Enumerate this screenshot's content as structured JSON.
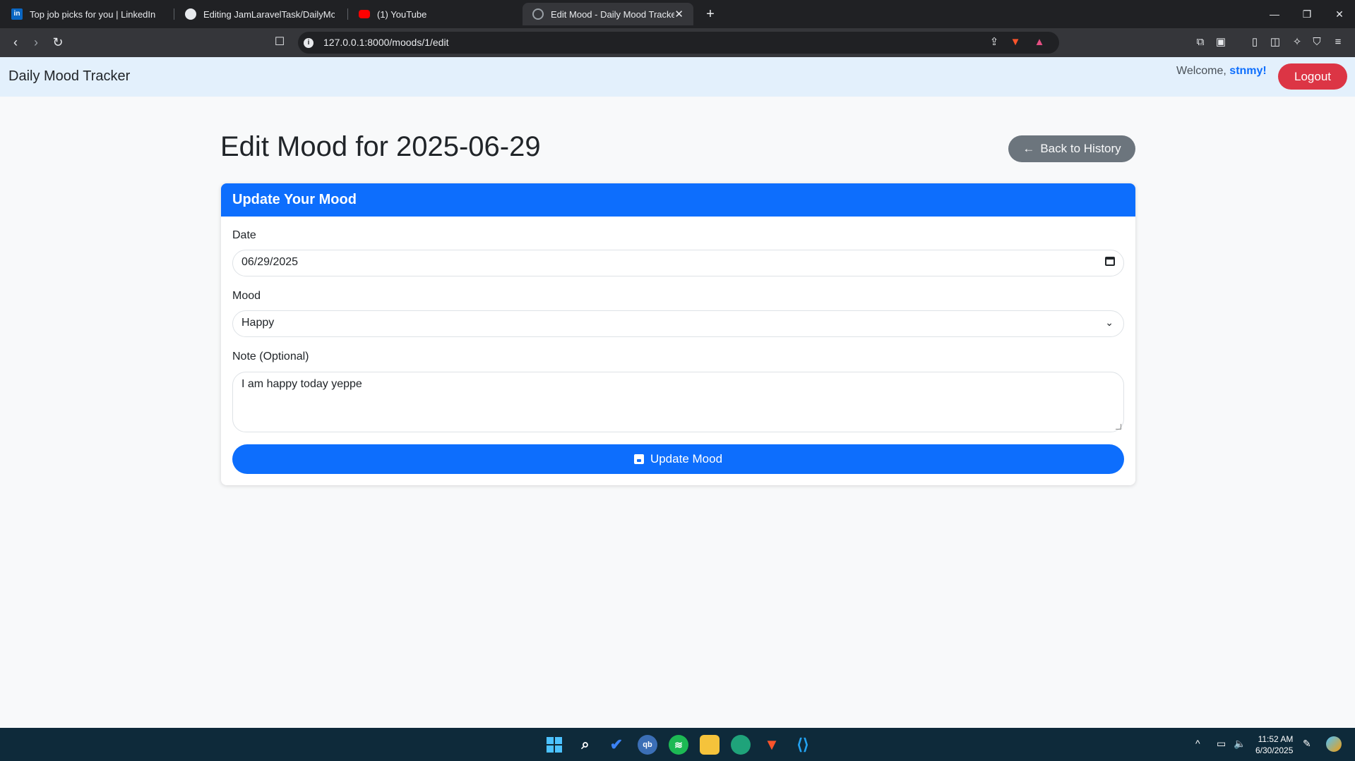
{
  "browser": {
    "tabs": [
      {
        "title": "Top job picks for you | LinkedIn",
        "icon": "linkedin-icon"
      },
      {
        "title": "Editing JamLaravelTask/DailyMood/R",
        "icon": "github-icon"
      },
      {
        "title": "(1) YouTube",
        "icon": "youtube-icon"
      },
      {
        "title": "Edit Mood - Daily Mood Tracker",
        "icon": "globe-icon",
        "active": true
      }
    ],
    "url": "127.0.0.1:8000/moods/1/edit"
  },
  "navbar": {
    "brand": "Daily Mood Tracker",
    "welcome_prefix": "Welcome,",
    "username": "stnmy!",
    "logout_label": "Logout"
  },
  "page": {
    "title": "Edit Mood for 2025-06-29",
    "back_label": "Back to History"
  },
  "form": {
    "header": "Update Your Mood",
    "date_label": "Date",
    "date_value": "06/29/2025",
    "mood_label": "Mood",
    "mood_value": "Happy",
    "note_label": "Note (Optional)",
    "note_value": "I am happy today yeppe",
    "submit_label": "Update Mood"
  },
  "taskbar": {
    "time": "11:52 AM",
    "date": "6/30/2025"
  },
  "colors": {
    "primary": "#0d6efd",
    "danger": "#dc3545",
    "secondary": "#6c757d",
    "navbar_bg": "#e3f0fc"
  }
}
